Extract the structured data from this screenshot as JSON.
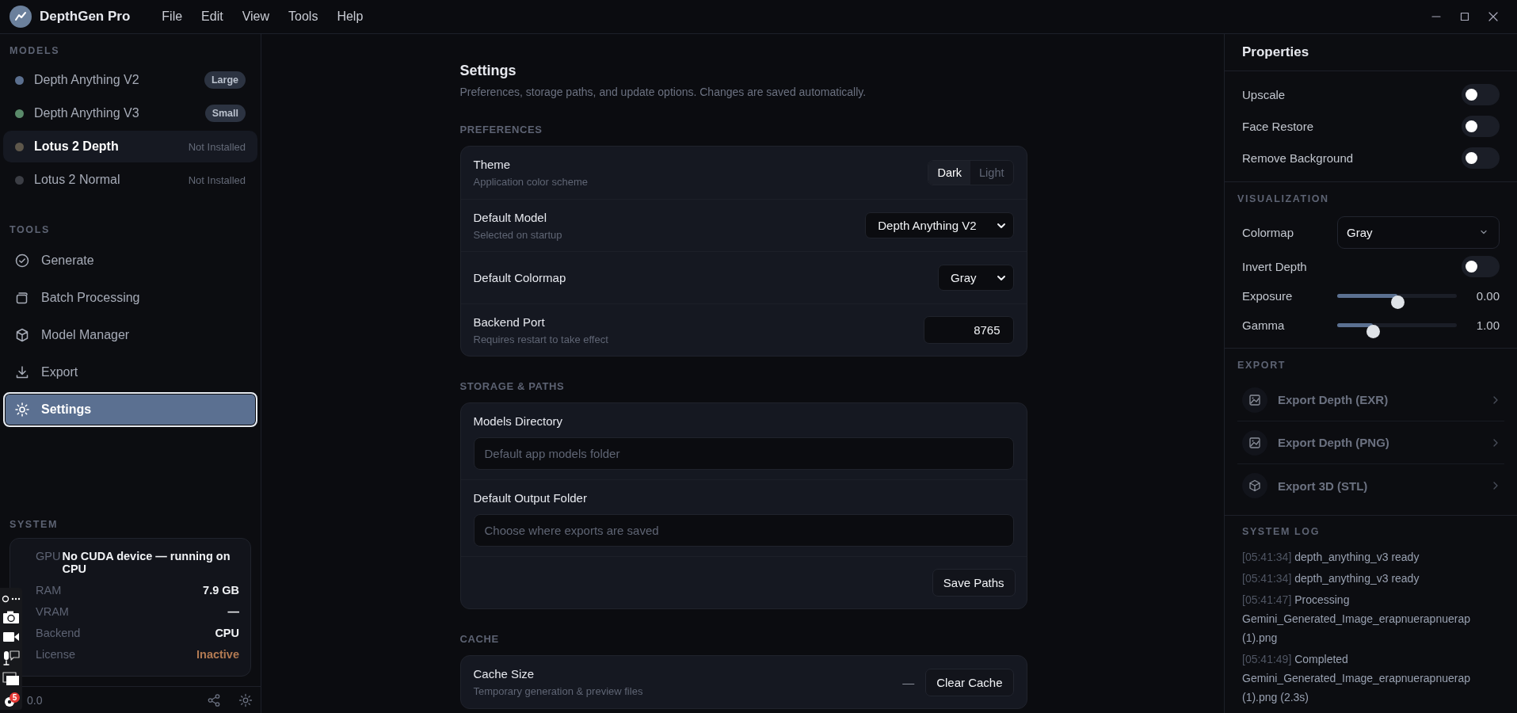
{
  "app": {
    "title": "DepthGen Pro"
  },
  "menu": [
    "File",
    "Edit",
    "View",
    "Tools",
    "Help"
  ],
  "sidebar": {
    "models_heading": "MODELS",
    "models": [
      {
        "name": "Depth Anything V2",
        "color": "#5b6f8f",
        "tag": "Large",
        "kind": "badge",
        "selected": false
      },
      {
        "name": "Depth Anything V3",
        "color": "#5a8a6a",
        "tag": "Small",
        "kind": "badge",
        "selected": false
      },
      {
        "name": "Lotus 2 Depth",
        "color": "#5e574b",
        "tag": "Not Installed",
        "kind": "status",
        "selected": true
      },
      {
        "name": "Lotus 2 Normal",
        "color": "#3c3e45",
        "tag": "Not Installed",
        "kind": "status",
        "selected": false
      }
    ],
    "tools_heading": "TOOLS",
    "tools": [
      {
        "label": "Generate",
        "selected": false
      },
      {
        "label": "Batch Processing",
        "selected": false
      },
      {
        "label": "Model Manager",
        "selected": false
      },
      {
        "label": "Export",
        "selected": false
      },
      {
        "label": "Settings",
        "selected": true
      }
    ],
    "system_heading": "SYSTEM",
    "system": [
      {
        "label": "GPU",
        "value": "No CUDA device — running on CPU",
        "kind": "wide"
      },
      {
        "label": "RAM",
        "value": "7.9 GB",
        "kind": "normal"
      },
      {
        "label": "VRAM",
        "value": "—",
        "kind": "normal"
      },
      {
        "label": "Backend",
        "value": "CPU",
        "kind": "normal"
      },
      {
        "label": "License",
        "value": "Inactive",
        "kind": "warning"
      }
    ],
    "version": "0.0"
  },
  "overlay": {
    "badge": "5"
  },
  "settings": {
    "title": "Settings",
    "subtitle": "Preferences, storage paths, and update options. Changes are saved automatically.",
    "sections": [
      {
        "heading": "PREFERENCES",
        "rows": [
          {
            "kind": "segmented",
            "label": "Theme",
            "hint": "Application color scheme",
            "options": [
              {
                "label": "Dark",
                "selected": true
              },
              {
                "label": "Light",
                "selected": false
              }
            ]
          },
          {
            "kind": "select",
            "label": "Default Model",
            "hint": "Selected on startup",
            "value": "Depth Anything V2"
          },
          {
            "kind": "select",
            "label": "Default Colormap",
            "value": "Gray"
          },
          {
            "kind": "number",
            "label": "Backend Port",
            "hint": "Requires restart to take effect",
            "value": "8765"
          }
        ]
      },
      {
        "heading": "STORAGE & PATHS",
        "rows": [
          {
            "kind": "path",
            "label": "Models Directory",
            "placeholder": "Default app models folder"
          },
          {
            "kind": "path",
            "label": "Default Output Folder",
            "placeholder": "Choose where exports are saved"
          },
          {
            "kind": "action",
            "button": "Save Paths"
          }
        ]
      },
      {
        "heading": "CACHE",
        "rows": [
          {
            "kind": "cache",
            "label": "Cache Size",
            "hint": "Temporary generation & preview files",
            "value": "—",
            "button": "Clear Cache"
          }
        ]
      }
    ]
  },
  "properties": {
    "title": "Properties",
    "toggles": [
      {
        "label": "Upscale",
        "on": false
      },
      {
        "label": "Face Restore",
        "on": false
      },
      {
        "label": "Remove Background",
        "on": false
      }
    ],
    "visualization_heading": "VISUALIZATION",
    "visualization": [
      {
        "kind": "select",
        "label": "Colormap",
        "value": "Gray"
      },
      {
        "kind": "toggle",
        "label": "Invert Depth",
        "on": false
      },
      {
        "kind": "slider",
        "label": "Exposure",
        "level": 0.5,
        "reading": "0.00"
      },
      {
        "kind": "slider",
        "label": "Gamma",
        "level": 0.3,
        "reading": "1.00"
      }
    ],
    "export_heading": "EXPORT",
    "exports": [
      {
        "label": "Export Depth (EXR)",
        "disabled": true
      },
      {
        "label": "Export Depth (PNG)",
        "disabled": true
      },
      {
        "label": "Export 3D (STL)",
        "disabled": true
      }
    ],
    "log_heading": "SYSTEM LOG",
    "log": [
      {
        "time": "[05:41:34]",
        "message": "depth_anything_v3 ready"
      },
      {
        "time": "[05:41:34]",
        "message": "depth_anything_v3 ready"
      },
      {
        "time": "[05:41:47]",
        "message": "Processing Gemini_Generated_Image_erapnuerapnuerap (1).png"
      },
      {
        "time": "[05:41:49]",
        "message": "Completed Gemini_Generated_Image_erapnuerapnuerap (1).png (2.3s)"
      }
    ]
  }
}
